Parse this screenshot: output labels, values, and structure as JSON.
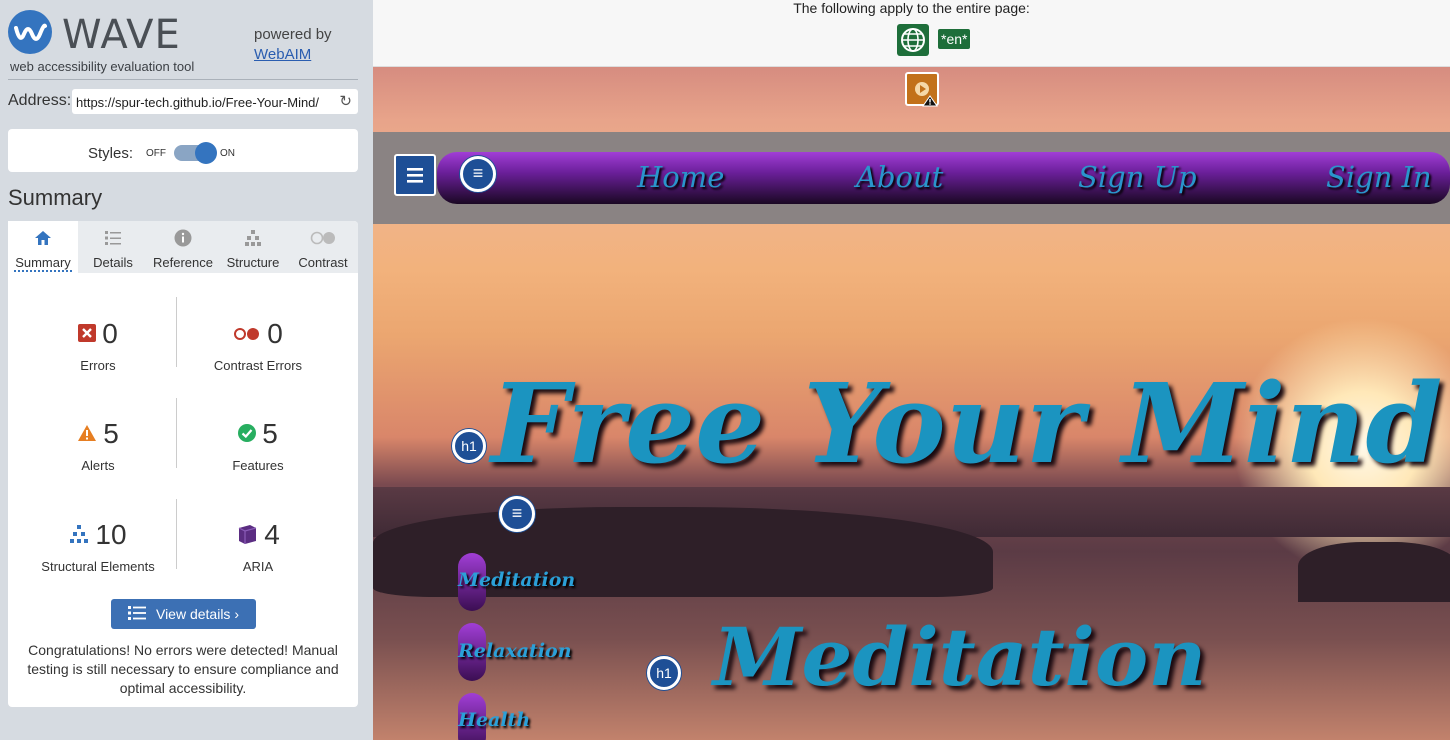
{
  "wave": {
    "title": "WAVE",
    "tagline": "web accessibility evaluation tool",
    "powered_by": "powered by",
    "webaim": "WebAIM",
    "address_label": "Address:",
    "address_value": "https://spur-tech.github.io/Free-Your-Mind/",
    "styles_label": "Styles:",
    "styles_off": "OFF",
    "styles_on": "ON",
    "summary_heading": "Summary",
    "tabs": [
      {
        "label": "Summary",
        "icon": "home-icon"
      },
      {
        "label": "Details",
        "icon": "list-icon"
      },
      {
        "label": "Reference",
        "icon": "info-icon"
      },
      {
        "label": "Structure",
        "icon": "hierarchy-icon"
      },
      {
        "label": "Contrast",
        "icon": "contrast-icon"
      }
    ],
    "stats": {
      "errors": {
        "value": "0",
        "label": "Errors"
      },
      "contrast_errors": {
        "value": "0",
        "label": "Contrast Errors"
      },
      "alerts": {
        "value": "5",
        "label": "Alerts"
      },
      "features": {
        "value": "5",
        "label": "Features"
      },
      "structural": {
        "value": "10",
        "label": "Structural Elements"
      },
      "aria": {
        "value": "4",
        "label": "ARIA"
      }
    },
    "view_details": "View details ›",
    "congrats": "Congratulations! No errors were detected! Manual testing is still necessary to ensure compliance and optimal accessibility."
  },
  "page": {
    "top_notice": "The following apply to the entire page:",
    "lang_badge": "*en*",
    "nav": [
      "Home",
      "About",
      "Sign Up",
      "Sign In"
    ],
    "hero_title": "Free Your Mind",
    "side_items": [
      "Meditation",
      "Relaxation",
      "Health"
    ],
    "section_title": "Meditation",
    "h1_badge": "h1"
  },
  "colors": {
    "wave_blue": "#3474bf",
    "nav_purple": "#a13ed6",
    "title_blue": "#1b94c0",
    "error_red": "#c0392b",
    "alert_orange": "#e67e22",
    "feature_green": "#27ae60"
  }
}
